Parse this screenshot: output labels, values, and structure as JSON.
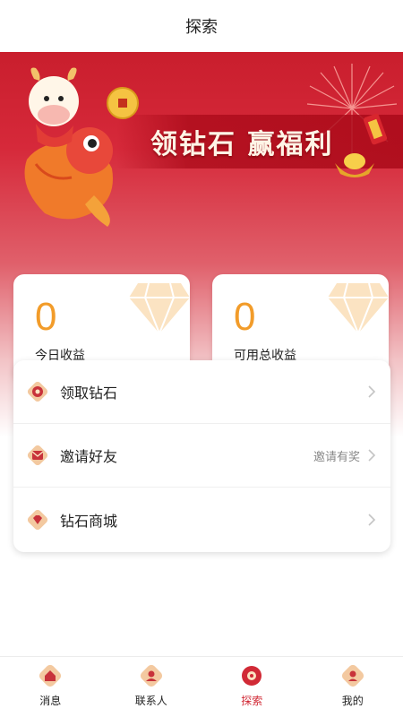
{
  "header": {
    "title": "探索"
  },
  "banner": {
    "slogan": "领钻石 赢福利"
  },
  "stats": [
    {
      "value": "0",
      "label": "今日收益"
    },
    {
      "value": "0",
      "label": "可用总收益"
    }
  ],
  "menu": {
    "items": [
      {
        "label": "领取钻石",
        "hint": "",
        "icon": "diamond-coin-icon"
      },
      {
        "label": "邀请好友",
        "hint": "邀请有奖",
        "icon": "envelope-icon"
      },
      {
        "label": "钻石商城",
        "hint": "",
        "icon": "gem-icon"
      }
    ]
  },
  "tabbar": {
    "tabs": [
      {
        "label": "消息",
        "icon": "message-icon",
        "active": false
      },
      {
        "label": "联系人",
        "icon": "contacts-icon",
        "active": false
      },
      {
        "label": "探索",
        "icon": "explore-icon",
        "active": true
      },
      {
        "label": "我的",
        "icon": "profile-icon",
        "active": false
      }
    ]
  },
  "colors": {
    "brand_red": "#d12a36",
    "stat_orange": "#f29c2a",
    "card_bg": "#ffffff"
  }
}
